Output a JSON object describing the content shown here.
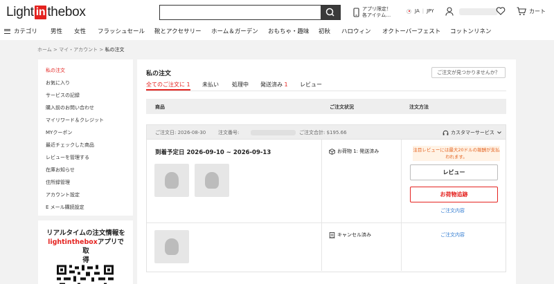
{
  "brand": {
    "logo_pre": "Light",
    "logo_in": "in",
    "logo_post": "thebox"
  },
  "search": {
    "placeholder": "",
    "button_icon": "search-icon"
  },
  "header": {
    "app_line1": "アプリ限定！",
    "app_line2": "各アイテム…",
    "lang": "JA",
    "currency": "JPY",
    "cart_label": "カート"
  },
  "nav": {
    "category_label": "カテゴリ",
    "items": [
      "男性",
      "女性",
      "フラッシュセール",
      "靴とアクセサリー",
      "ホーム＆ガーデン",
      "おもちゃ・趣味",
      "初秋",
      "ハロウィン",
      "オクトーバーフェスト",
      "コットンリネン"
    ]
  },
  "breadcrumb": {
    "home": "ホーム",
    "account": "マイ・アカウント",
    "current": "私の注文",
    "sep": ">"
  },
  "sidebar": {
    "items": [
      "私の注文",
      "お気に入り",
      "サービスの記録",
      "購入前のお問い合わせ",
      "マイリワード＆クレジット",
      "MYクーポン",
      "最近チェックした商品",
      "レビューを管理する",
      "在庫お知らせ",
      "住所録管理",
      "アカウント設定",
      "E メール購読設定"
    ]
  },
  "promo": {
    "line_a": "リアルタイムの注文情報を",
    "line_b_red": "lightinthebox",
    "line_b_rest": "アプリで取",
    "line_c": "得"
  },
  "orders": {
    "title": "私の注文",
    "not_found": "ご注文が見つかりませんか？",
    "tabs": [
      {
        "label": "全てのご注文に",
        "count": "1"
      },
      {
        "label": "未払い",
        "count": ""
      },
      {
        "label": "処理中",
        "count": ""
      },
      {
        "label": "発送済み",
        "count": "1"
      },
      {
        "label": "レビュー",
        "count": ""
      }
    ],
    "columns": [
      "商品",
      "ご注文状況",
      "注文方法"
    ],
    "order": {
      "date": "ご注文日: 2026-08-30",
      "number_label": "注文番号:",
      "total": "ご注文合計: $195.66",
      "customer_service": "カスタマーサービス",
      "packages": [
        {
          "eta": "到着予定日 2026-09-10 ~ 2026-09-13",
          "status": "お荷物 1: 発送済み",
          "note": "注目レビューには最大20ドルの報酬が支払われます。",
          "review_label": "レビュー",
          "track_label": "お荷物追跡",
          "details_label": "ご注文内容"
        },
        {
          "status": "キャンセル済み",
          "details_label": "ご注文内容"
        }
      ]
    }
  },
  "colors": {
    "accent": "#e4221f",
    "link": "#2f7ad0",
    "note_text": "#e4621f"
  }
}
